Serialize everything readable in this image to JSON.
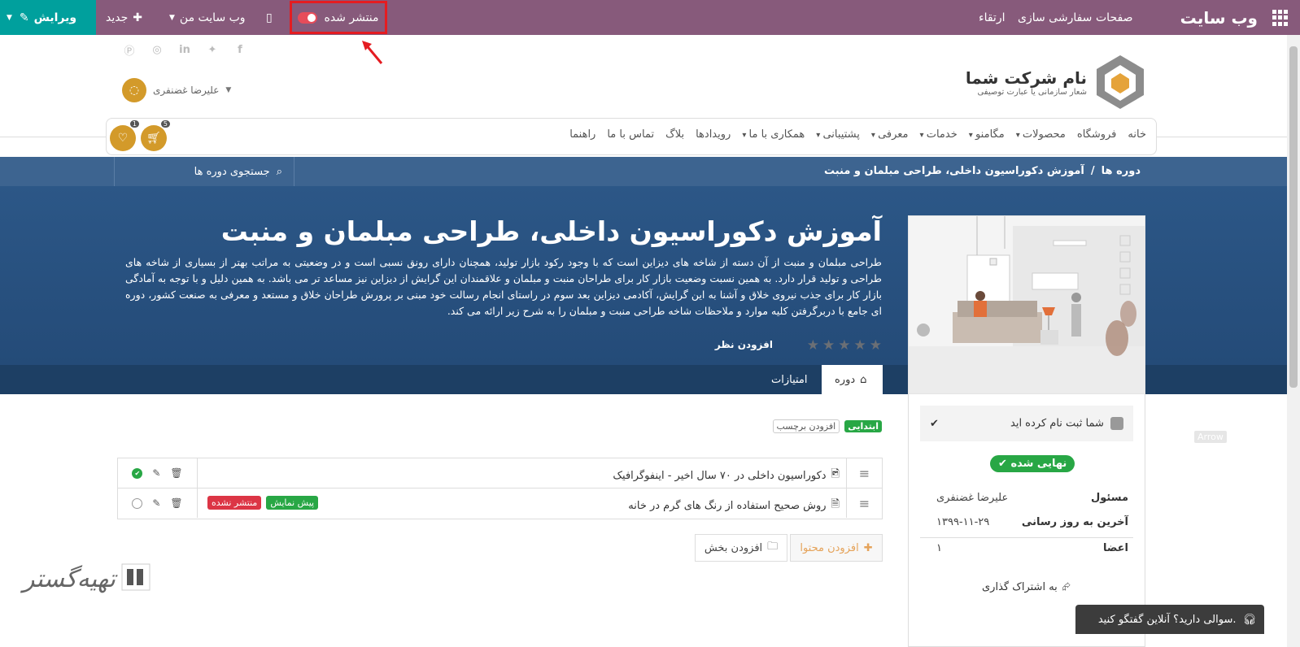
{
  "topbar": {
    "brand": "وب سایت",
    "menu": [
      "صفحات",
      "سفارشی سازی",
      "ارتقاء"
    ],
    "publish_label": "منتشر شده",
    "my_website_label": "وب سایت من",
    "new_label": "جدید",
    "edit_label": "ویرایش"
  },
  "header": {
    "user_name": "علیرضا غضنفری",
    "logo_title": "نام شرکت شما",
    "logo_subtitle": "شعار سازمانی یا عبارت توصیفی",
    "nav": [
      {
        "label": "خانه",
        "dropdown": false
      },
      {
        "label": "فروشگاه",
        "dropdown": false
      },
      {
        "label": "محصولات",
        "dropdown": true
      },
      {
        "label": "مگامنو",
        "dropdown": true
      },
      {
        "label": "خدمات",
        "dropdown": true
      },
      {
        "label": "معرفی",
        "dropdown": true
      },
      {
        "label": "پشتیبانی",
        "dropdown": true
      },
      {
        "label": "همکاری با ما",
        "dropdown": true
      },
      {
        "label": "رویدادها",
        "dropdown": false
      },
      {
        "label": "بلاگ",
        "dropdown": false
      },
      {
        "label": "تماس با ما",
        "dropdown": false
      },
      {
        "label": "راهنما",
        "dropdown": false
      }
    ],
    "cart_count": "5",
    "wishlist_count": "1"
  },
  "breadcrumb": {
    "root": "دوره ها",
    "separator": "/",
    "current": "آموزش دکوراسیون داخلی، طراحی مبلمان و منبت"
  },
  "search": {
    "placeholder": "جستجوی دوره ها"
  },
  "course": {
    "title": "آموزش دکوراسیون داخلی، طراحی مبلمان و منبت",
    "description": "طراحی مبلمان و منبت از آن دسته از شاخه های دیزاین است که با وجود رکود بازار تولید، همچنان دارای رونق نسبی است و در وضعیتی به مراتب بهتر از بسیاری از شاخه های طراحی و تولید قرار دارد. به همین نسبت وضعیت بازار کار برای طراحان منبت و مبلمان و علاقمندان این گرایش از دیزاین نیز مساعد تر می باشد. به همین دلیل و با توجه به آمادگی بازار کار برای جذب نیروی خلاق و آشنا به این گرایش، آکادمی دیزاین بعد سوم در راستای انجام رسالت خود مبنی بر پرورش طراحان خلاق و مستعد و معرفی به صنعت کشور، دوره ای جامع با دربرگرفتن کلیه موارد و ملاحظات شاخه طراحی منبت و مبلمان را به شرح زیر ارائه می کند.",
    "rating": 0,
    "rating_max": 5,
    "add_review_label": "افزودن نظر",
    "tabs": [
      "دوره",
      "امتیازات"
    ],
    "tags": [
      "ابتدایی"
    ],
    "add_tag_label": "افزودن برچسب"
  },
  "contents": [
    {
      "title": "دکوراسیون داخلی در ۷۰ سال اخیر - اینفوگرافیک",
      "icon": "image-file-icon",
      "published": true,
      "badges": []
    },
    {
      "title": "روش صحیح استفاده از رنگ های گرم در خانه",
      "icon": "document-file-icon",
      "published": false,
      "badges": [
        "پیش نمایش",
        "منتشر نشده"
      ]
    }
  ],
  "buttons": {
    "add_content": "افزودن محتوا",
    "add_section": "افزودن بخش"
  },
  "sidecard": {
    "enrolled_label": "شما ثبت نام کرده اید",
    "status_badge": "نهایی شده",
    "responsible_label": "مسئول",
    "responsible_value": "علیرضا غضنفری",
    "updated_label": "آخرین به روز رسانی",
    "updated_value": "۱۳۹۹-۱۱-۲۹",
    "members_label": "اعضا",
    "members_value": "۱",
    "share_label": "به اشتراک گذاری"
  },
  "chat": {
    "label": "سوالی دارید؟ آنلاین گفتگو کنید."
  },
  "arrow_label": "Arrow",
  "watermark": "تهیه‌گستر",
  "colors": {
    "topbar": "#875a7b",
    "edit": "#00a09d",
    "hero": "#2c5787",
    "accent": "#d39a2a",
    "success": "#28a745",
    "danger": "#dc3545",
    "highlight": "#e41c21"
  }
}
